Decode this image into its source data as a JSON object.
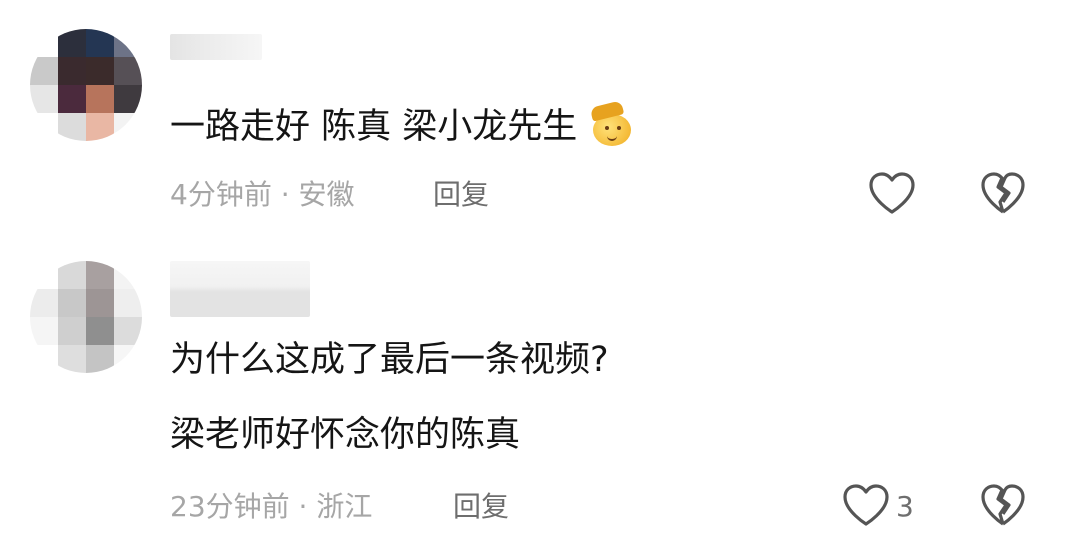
{
  "comments": [
    {
      "text": "一路走好 陈真 梁小龙先生",
      "emoji": "saluting-face-icon",
      "time": "4分钟前",
      "separator": " · ",
      "location": "安徽",
      "reply_label": "回复"
    },
    {
      "text_lines": [
        "为什么这成了最后一条视频?",
        "梁老师好怀念你的陈真"
      ],
      "time": "23分钟前",
      "separator": " · ",
      "location": "浙江",
      "reply_label": "回复",
      "like_count": "3"
    }
  ],
  "colors": {
    "text": "#151515",
    "meta": "#a6a6a6",
    "action": "#6e6e6e",
    "icon_stroke": "#555555"
  }
}
